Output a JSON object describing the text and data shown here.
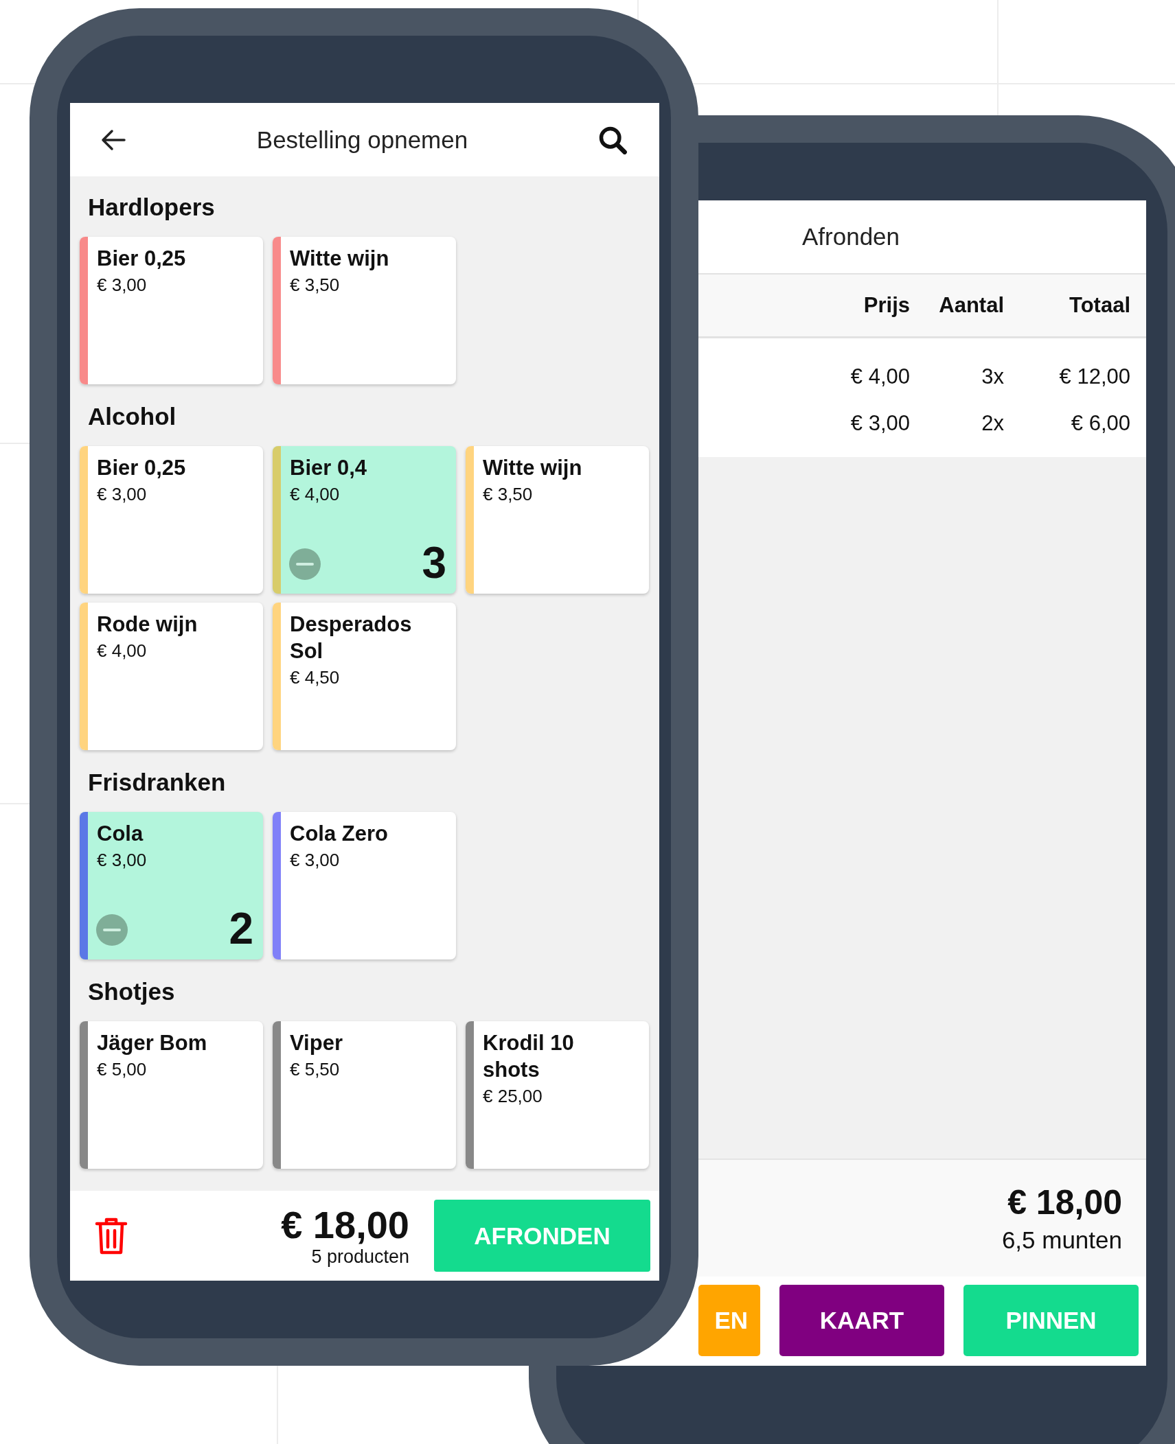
{
  "front": {
    "header": {
      "title": "Bestelling opnemen"
    },
    "sections": [
      {
        "title": "Hardlopers",
        "products": [
          {
            "name": "Bier 0,25",
            "price": "€ 3,00",
            "color": "#f88a8a",
            "selected": false
          },
          {
            "name": "Witte wijn",
            "price": "€ 3,50",
            "color": "#f88a8a",
            "selected": false
          }
        ]
      },
      {
        "title": "Alcohol",
        "products": [
          {
            "name": "Bier 0,25",
            "price": "€ 3,00",
            "color": "#ffd47f",
            "selected": false
          },
          {
            "name": "Bier 0,4",
            "price": "€ 4,00",
            "color": "#d8cc6a",
            "selected": true,
            "count": "3"
          },
          {
            "name": "Witte wijn",
            "price": "€ 3,50",
            "color": "#ffd47f",
            "selected": false
          },
          {
            "name": "Rode wijn",
            "price": "€ 4,00",
            "color": "#ffd47f",
            "selected": false
          },
          {
            "name": "Desperados Sol",
            "price": "€ 4,50",
            "color": "#ffd47f",
            "selected": false
          }
        ]
      },
      {
        "title": "Frisdranken",
        "products": [
          {
            "name": "Cola",
            "price": "€ 3,00",
            "color": "#5a78e6",
            "selected": true,
            "count": "2"
          },
          {
            "name": "Cola Zero",
            "price": "€ 3,00",
            "color": "#8080f8",
            "selected": false
          }
        ]
      },
      {
        "title": "Shotjes",
        "products": [
          {
            "name": "Jäger Bom",
            "price": "€ 5,00",
            "color": "#888888",
            "selected": false
          },
          {
            "name": "Viper",
            "price": "€ 5,50",
            "color": "#888888",
            "selected": false
          },
          {
            "name": "Krodil 10 shots",
            "price": "€ 25,00",
            "color": "#888888",
            "selected": false
          }
        ]
      }
    ],
    "footer": {
      "total": "€ 18,00",
      "count": "5 producten",
      "button": "AFRONDEN"
    }
  },
  "back": {
    "header": {
      "title": "Afronden"
    },
    "table": {
      "columns": [
        "Prijs",
        "Aantal",
        "Totaal"
      ],
      "rows": [
        [
          "€ 4,00",
          "3x",
          "€ 12,00"
        ],
        [
          "€ 3,00",
          "2x",
          "€ 6,00"
        ]
      ]
    },
    "summary": {
      "total": "€ 18,00",
      "coins": "6,5 munten"
    },
    "buttons": [
      {
        "label": "EN",
        "color": "#ffa500"
      },
      {
        "label": "KAART",
        "color": "#800080"
      },
      {
        "label": "PINNEN",
        "color": "#14db8e"
      }
    ]
  }
}
